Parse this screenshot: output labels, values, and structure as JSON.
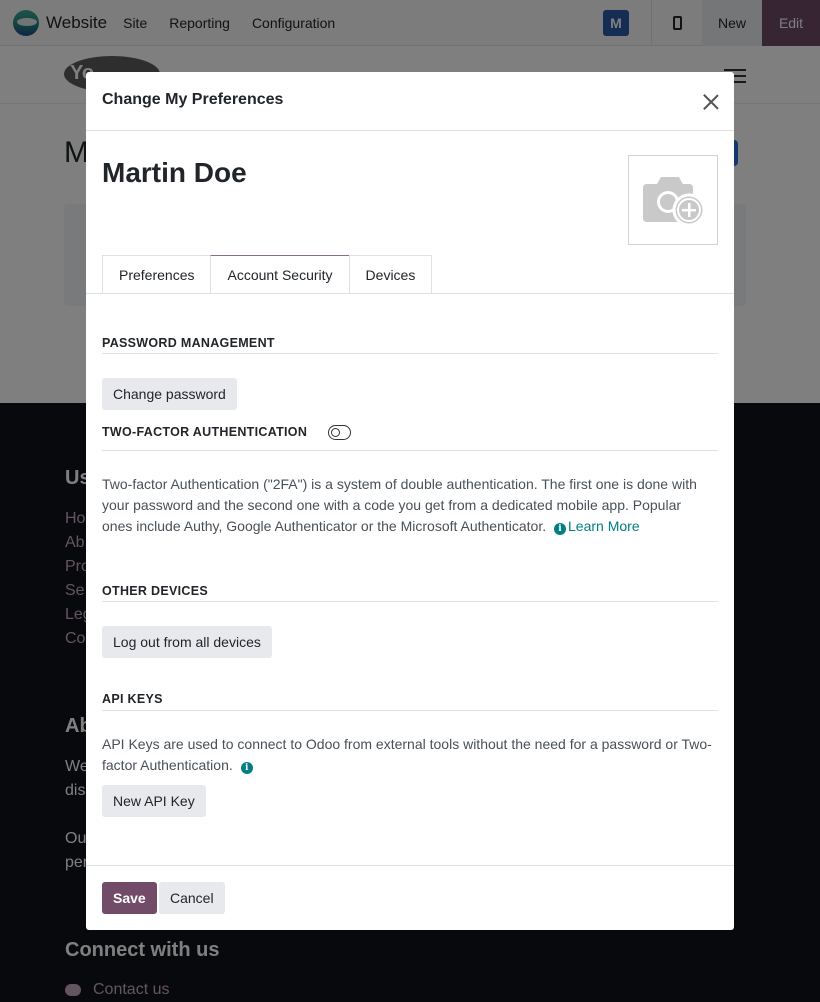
{
  "topbar": {
    "brand": "Website",
    "menu": [
      "Site",
      "Reporting",
      "Configuration"
    ],
    "avatar_letter": "M",
    "new_label": "New",
    "edit_label": "Edit",
    "edit_color": "#714b67"
  },
  "site": {
    "logo_text": "Yo",
    "page_title": "M",
    "footer": {
      "heading1": "Us",
      "links": [
        "Ho",
        "Ab",
        "Pro",
        "Se",
        "Leg",
        "Co"
      ],
      "heading2": "Ab",
      "text1": [
        "We",
        "dis"
      ],
      "text2": [
        "Ou",
        "per"
      ],
      "connect_heading": "Connect with us",
      "contact_label": "Contact us"
    }
  },
  "modal": {
    "title": "Change My Preferences",
    "user_name": "Martin Doe",
    "tabs": [
      {
        "label": "Preferences",
        "active": false
      },
      {
        "label": "Account Security",
        "active": true
      },
      {
        "label": "Devices",
        "active": false
      }
    ],
    "password_section": {
      "title": "PASSWORD MANAGEMENT",
      "button": "Change password"
    },
    "twofa_section": {
      "title": "TWO-FACTOR AUTHENTICATION",
      "enabled": false,
      "description": "Two-factor Authentication (\"2FA\") is a system of double authentication. The first one is done with your password and the second one with a code you get from a dedicated mobile app. Popular ones include Authy, Google Authenticator or the Microsoft Authenticator.",
      "learn_more": "Learn More"
    },
    "devices_section": {
      "title": "OTHER DEVICES",
      "button": "Log out from all devices"
    },
    "api_section": {
      "title": "API KEYS",
      "description": "API Keys are used to connect to Odoo from external tools without the need for a password or Two-factor Authentication.",
      "button": "New API Key"
    },
    "footer": {
      "save": "Save",
      "cancel": "Cancel"
    }
  }
}
